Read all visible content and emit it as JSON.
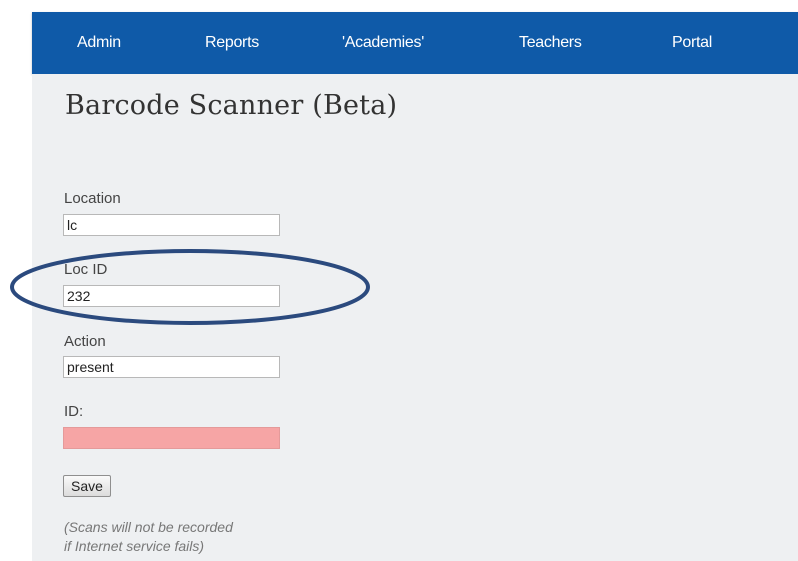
{
  "nav": {
    "items": [
      "Admin",
      "Reports",
      "'Academies'",
      "Teachers",
      "Portal"
    ]
  },
  "page": {
    "title": "Barcode Scanner (Beta)"
  },
  "form": {
    "location": {
      "label": "Location",
      "value": "lc"
    },
    "loc_id": {
      "label": "Loc ID",
      "value": "232"
    },
    "action": {
      "label": "Action",
      "value": "present"
    },
    "id": {
      "label": "ID:",
      "value": ""
    },
    "save_label": "Save"
  },
  "note": {
    "line1": "(Scans will not be recorded",
    "line2": "if Internet service fails)"
  },
  "colors": {
    "nav_bg": "#0f5aa8",
    "content_bg": "#eef0f2",
    "error_field": "#f6a5a5",
    "annotation_ellipse": "#2b4a7e"
  }
}
